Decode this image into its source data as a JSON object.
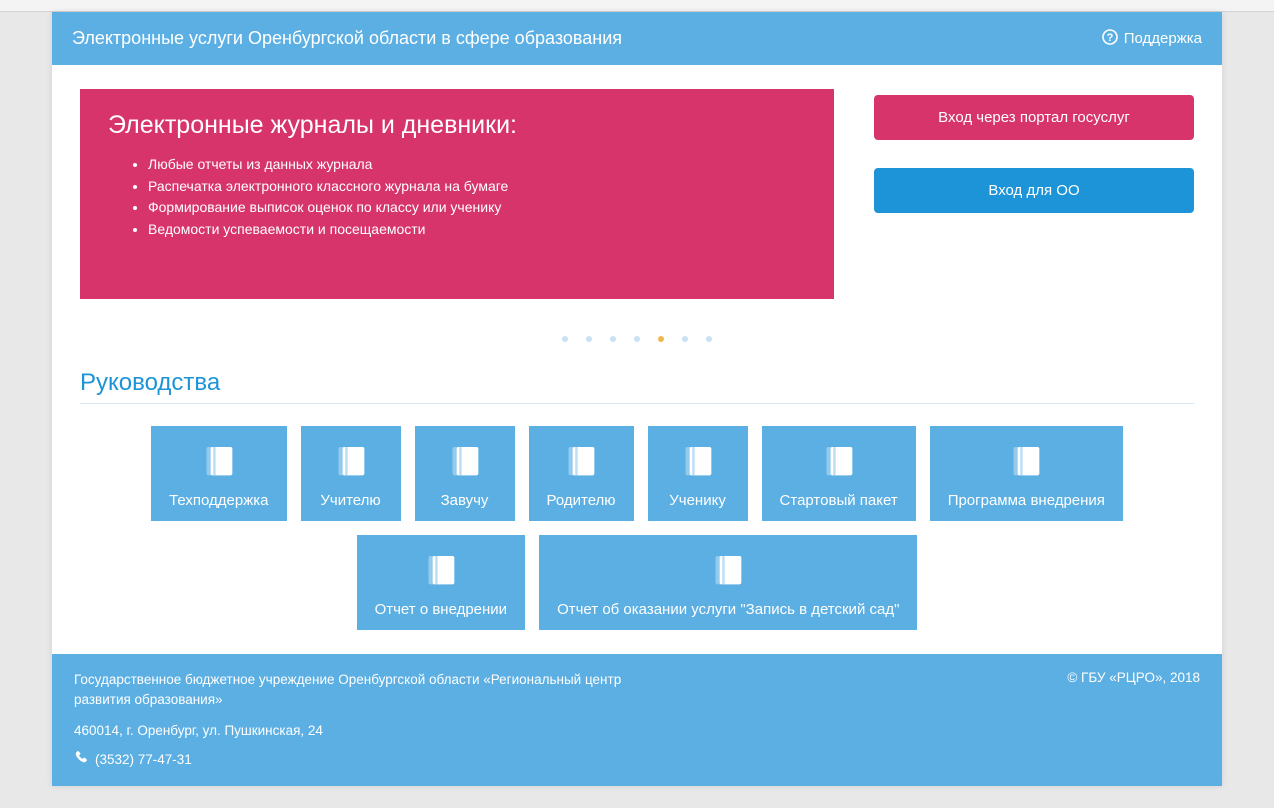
{
  "header": {
    "title": "Электронные услуги Оренбургской области в сфере образования",
    "support_label": "Поддержка"
  },
  "hero": {
    "title": "Электронные журналы и дневники:",
    "bullets": [
      "Любые отчеты из данных журнала",
      "Распечатка электронного классного журнала на бумаге",
      "Формирование выписок оценок по классу или ученику",
      "Ведомости успеваемости и посещаемости"
    ]
  },
  "side_buttons": {
    "gosuslugi": "Вход через портал госуслуг",
    "oo_login": "Вход для ОО"
  },
  "carousel": {
    "count": 7,
    "active_index": 4
  },
  "guides": {
    "section_title": "Руководства",
    "row1": [
      "Техподдержка",
      "Учителю",
      "Завучу",
      "Родителю",
      "Ученику",
      "Стартовый пакет",
      "Программа внедрения"
    ],
    "row2": [
      "Отчет о внедрении",
      "Отчет об оказании услуги \"Запись в детский сад\""
    ]
  },
  "footer": {
    "org": "Государственное бюджетное учреждение Оренбургской области «Региональный центр развития образования»",
    "address": "460014, г. Оренбург, ул. Пушкинская, 24",
    "phone": "(3532) 77-47-31",
    "copyright": "© ГБУ «РЦРО», 2018"
  }
}
